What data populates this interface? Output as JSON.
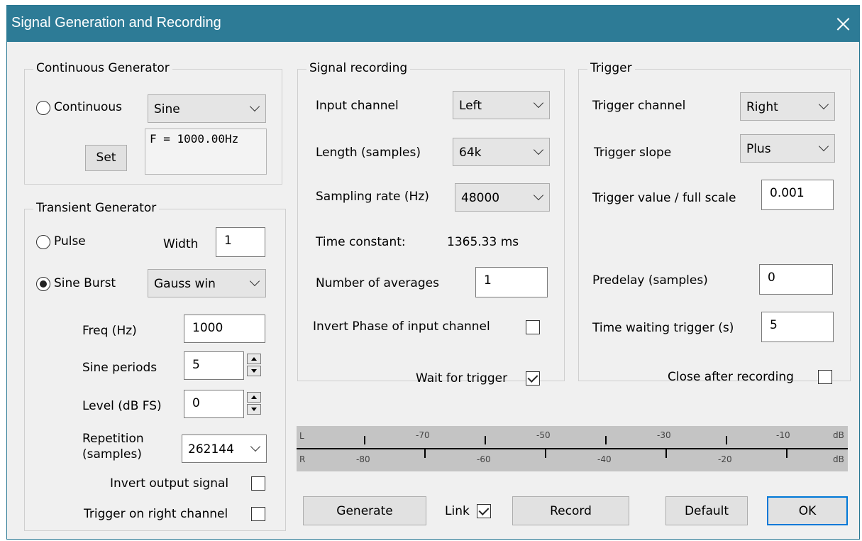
{
  "window": {
    "title": "Signal Generation and Recording"
  },
  "continuous": {
    "group_title": "Continuous Generator",
    "radio_label": "Continuous",
    "waveform": "Sine",
    "set_button": "Set",
    "readout": "F = 1000.00Hz"
  },
  "transient": {
    "group_title": "Transient Generator",
    "pulse_label": "Pulse",
    "width_label": "Width",
    "width_value": "1",
    "burst_label": "Sine Burst",
    "burst_window": "Gauss win",
    "freq_label": "Freq (Hz)",
    "freq_value": "1000",
    "periods_label": "Sine periods",
    "periods_value": "5",
    "level_label": "Level (dB FS)",
    "level_value": "0",
    "repetition_label_1": "Repetition",
    "repetition_label_2": "(samples)",
    "repetition_value": "262144",
    "invert_label": "Invert output signal",
    "trigger_right_label": "Trigger on right channel"
  },
  "recording": {
    "group_title": "Signal recording",
    "input_label": "Input channel",
    "input_value": "Left",
    "length_label": "Length (samples)",
    "length_value": "64k",
    "rate_label": "Sampling rate (Hz)",
    "rate_value": "48000",
    "time_const_label": "Time constant:",
    "time_const_value": "1365.33 ms",
    "averages_label": "Number of averages",
    "averages_value": "1",
    "invert_phase_label": "Invert Phase of input channel",
    "wait_trigger_label": "Wait for trigger"
  },
  "trigger": {
    "group_title": "Trigger",
    "channel_label": "Trigger channel",
    "channel_value": "Right",
    "slope_label": "Trigger slope",
    "slope_value": "Plus",
    "value_label": "Trigger value / full scale",
    "value_value": "0.001",
    "predelay_label": "Predelay (samples)",
    "predelay_value": "0",
    "waiting_label": "Time waiting trigger (s)",
    "waiting_value": "5",
    "close_label": "Close after recording"
  },
  "meter": {
    "left_channel": "L",
    "right_channel": "R",
    "left_scale": [
      "-70",
      "-50",
      "-30",
      "-10"
    ],
    "right_scale": [
      "-80",
      "-60",
      "-40",
      "-20"
    ],
    "unit": "dB"
  },
  "buttons": {
    "generate": "Generate",
    "link": "Link",
    "record": "Record",
    "default": "Default",
    "ok": "OK"
  },
  "state": {
    "continuous_checked": false,
    "pulse_checked": false,
    "burst_checked": true,
    "invert_output_checked": false,
    "trigger_right_checked": false,
    "invert_phase_checked": false,
    "wait_trigger_checked": true,
    "close_after_checked": false,
    "link_checked": true
  },
  "colors": {
    "titlebar": "#2d7b96",
    "dialog_bg": "#f0f0f0",
    "default_button_border": "#0078d7"
  }
}
